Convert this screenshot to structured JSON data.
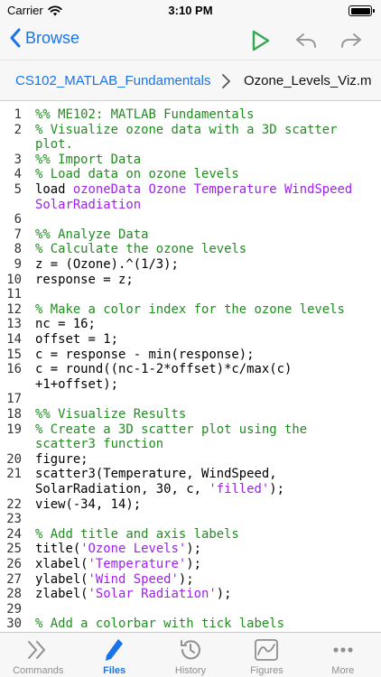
{
  "status_bar": {
    "carrier": "Carrier",
    "time": "3:10 PM"
  },
  "nav": {
    "back_label": "Browse"
  },
  "breadcrumb": {
    "parent": "CS102_MATLAB_Fundamentals",
    "current": "Ozone_Levels_Viz.m"
  },
  "editor": {
    "lines": [
      {
        "num": "1",
        "segments": [
          {
            "text": "%% ME102: MATLAB Fundamentals",
            "kind": "comment"
          }
        ]
      },
      {
        "num": "2",
        "segments": [
          {
            "text": "% Visualize ozone data with a 3D scatter",
            "kind": "comment"
          }
        ]
      },
      {
        "num": "",
        "segments": [
          {
            "text": "plot.",
            "kind": "comment"
          }
        ]
      },
      {
        "num": "3",
        "segments": [
          {
            "text": "%% Import Data",
            "kind": "comment"
          }
        ]
      },
      {
        "num": "4",
        "segments": [
          {
            "text": "% Load data on ozone levels",
            "kind": "comment"
          }
        ]
      },
      {
        "num": "5",
        "segments": [
          {
            "text": "load ",
            "kind": "code"
          },
          {
            "text": "ozoneData Ozone Temperature WindSpeed",
            "kind": "string"
          }
        ]
      },
      {
        "num": "",
        "segments": [
          {
            "text": "SolarRadiation",
            "kind": "string"
          }
        ]
      },
      {
        "num": "6",
        "segments": []
      },
      {
        "num": "7",
        "segments": [
          {
            "text": "%% Analyze Data",
            "kind": "comment"
          }
        ]
      },
      {
        "num": "8",
        "segments": [
          {
            "text": "% Calculate the ozone levels",
            "kind": "comment"
          }
        ]
      },
      {
        "num": "9",
        "segments": [
          {
            "text": "z = (Ozone).^(1/3);",
            "kind": "code"
          }
        ]
      },
      {
        "num": "10",
        "segments": [
          {
            "text": "response = z;",
            "kind": "code"
          }
        ]
      },
      {
        "num": "11",
        "segments": []
      },
      {
        "num": "12",
        "segments": [
          {
            "text": "% Make a color index for the ozone levels",
            "kind": "comment"
          }
        ]
      },
      {
        "num": "13",
        "segments": [
          {
            "text": "nc = 16;",
            "kind": "code"
          }
        ]
      },
      {
        "num": "14",
        "segments": [
          {
            "text": "offset = 1;",
            "kind": "code"
          }
        ]
      },
      {
        "num": "15",
        "segments": [
          {
            "text": "c = response - min(response);",
            "kind": "code"
          }
        ]
      },
      {
        "num": "16",
        "segments": [
          {
            "text": "c = round((nc-1-2*offset)*c/max(c)",
            "kind": "code"
          }
        ]
      },
      {
        "num": "",
        "segments": [
          {
            "text": "+1+offset);",
            "kind": "code"
          }
        ]
      },
      {
        "num": "17",
        "segments": []
      },
      {
        "num": "18",
        "segments": [
          {
            "text": "%% Visualize Results",
            "kind": "comment"
          }
        ]
      },
      {
        "num": "19",
        "segments": [
          {
            "text": "% Create a 3D scatter plot using the",
            "kind": "comment"
          }
        ]
      },
      {
        "num": "",
        "segments": [
          {
            "text": "scatter3 function",
            "kind": "comment"
          }
        ]
      },
      {
        "num": "20",
        "segments": [
          {
            "text": "figure;",
            "kind": "code"
          }
        ]
      },
      {
        "num": "21",
        "segments": [
          {
            "text": "scatter3(Temperature, WindSpeed,",
            "kind": "code"
          }
        ]
      },
      {
        "num": "",
        "segments": [
          {
            "text": "SolarRadiation, 30, c, ",
            "kind": "code"
          },
          {
            "text": "'filled'",
            "kind": "string"
          },
          {
            "text": ");",
            "kind": "code"
          }
        ]
      },
      {
        "num": "22",
        "segments": [
          {
            "text": "view(-34, 14);",
            "kind": "code"
          }
        ]
      },
      {
        "num": "23",
        "segments": []
      },
      {
        "num": "24",
        "segments": [
          {
            "text": "% Add title and axis labels",
            "kind": "comment"
          }
        ]
      },
      {
        "num": "25",
        "segments": [
          {
            "text": "title(",
            "kind": "code"
          },
          {
            "text": "'Ozone Levels'",
            "kind": "string"
          },
          {
            "text": ");",
            "kind": "code"
          }
        ]
      },
      {
        "num": "26",
        "segments": [
          {
            "text": "xlabel(",
            "kind": "code"
          },
          {
            "text": "'Temperature'",
            "kind": "string"
          },
          {
            "text": ");",
            "kind": "code"
          }
        ]
      },
      {
        "num": "27",
        "segments": [
          {
            "text": "ylabel(",
            "kind": "code"
          },
          {
            "text": "'Wind Speed'",
            "kind": "string"
          },
          {
            "text": ");",
            "kind": "code"
          }
        ]
      },
      {
        "num": "28",
        "segments": [
          {
            "text": "zlabel(",
            "kind": "code"
          },
          {
            "text": "'Solar Radiation'",
            "kind": "string"
          },
          {
            "text": ");",
            "kind": "code"
          }
        ]
      },
      {
        "num": "29",
        "segments": []
      },
      {
        "num": "30",
        "segments": [
          {
            "text": "% Add a colorbar with tick labels",
            "kind": "comment"
          }
        ]
      }
    ]
  },
  "tabs": [
    {
      "label": "Commands",
      "icon": "commands-icon",
      "active": false
    },
    {
      "label": "Files",
      "icon": "files-icon",
      "active": true
    },
    {
      "label": "History",
      "icon": "history-icon",
      "active": false
    },
    {
      "label": "Figures",
      "icon": "figures-icon",
      "active": false
    },
    {
      "label": "More",
      "icon": "more-icon",
      "active": false
    }
  ],
  "colors": {
    "accent": "#1a73e8",
    "run_green": "#34a853",
    "comment_green": "#228b22",
    "string_purple": "#a020f0",
    "inactive_gray": "#8e8e93"
  }
}
